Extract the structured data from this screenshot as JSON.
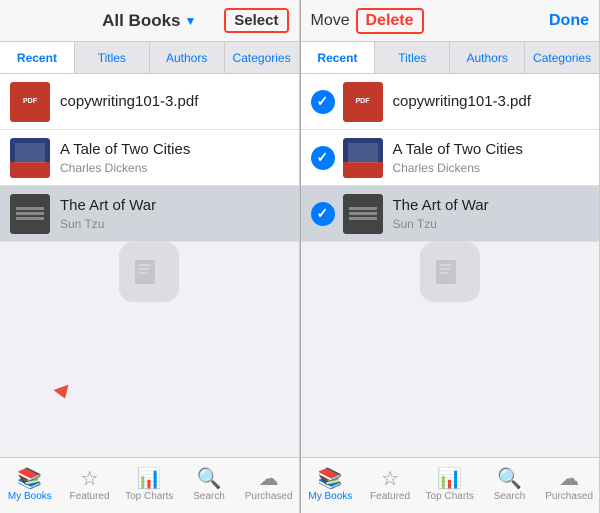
{
  "left_panel": {
    "header": {
      "title": "All Books",
      "title_chevron": "▼",
      "select_label": "Select"
    },
    "tabs": [
      {
        "label": "Recent",
        "active": true
      },
      {
        "label": "Titles",
        "active": false
      },
      {
        "label": "Authors",
        "active": false
      },
      {
        "label": "Categories",
        "active": false
      }
    ],
    "books": [
      {
        "id": "pdf",
        "title": "copywriting101-3.pdf",
        "author": "",
        "cover_type": "pdf"
      },
      {
        "id": "tale",
        "title": "A Tale of Two Cities",
        "author": "Charles Dickens",
        "cover_type": "tale"
      },
      {
        "id": "war",
        "title": "The Art of War",
        "author": "Sun Tzu",
        "cover_type": "war",
        "highlighted": true
      }
    ],
    "tab_bar": [
      {
        "label": "My Books",
        "active": true,
        "icon": "books"
      },
      {
        "label": "Featured",
        "active": false,
        "icon": "star"
      },
      {
        "label": "Top Charts",
        "active": false,
        "icon": "chart"
      },
      {
        "label": "Search",
        "active": false,
        "icon": "search"
      },
      {
        "label": "Purchased",
        "active": false,
        "icon": "cloud"
      }
    ]
  },
  "right_panel": {
    "header": {
      "move_label": "Move",
      "delete_label": "Delete",
      "done_label": "Done"
    },
    "tabs": [
      {
        "label": "Recent",
        "active": true
      },
      {
        "label": "Titles",
        "active": false
      },
      {
        "label": "Authors",
        "active": false
      },
      {
        "label": "Categories",
        "active": false
      }
    ],
    "books": [
      {
        "id": "pdf",
        "title": "copywriting101-3.pdf",
        "author": "",
        "cover_type": "pdf",
        "selected": true
      },
      {
        "id": "tale",
        "title": "A Tale of Two Cities",
        "author": "Charles Dickens",
        "cover_type": "tale",
        "selected": true
      },
      {
        "id": "war",
        "title": "The Art of War",
        "author": "Sun Tzu",
        "cover_type": "war",
        "selected": true,
        "highlighted": true
      }
    ],
    "tab_bar": [
      {
        "label": "My Books",
        "active": true,
        "icon": "books"
      },
      {
        "label": "Featured",
        "active": false,
        "icon": "star"
      },
      {
        "label": "Top Charts",
        "active": false,
        "icon": "chart"
      },
      {
        "label": "Search",
        "active": false,
        "icon": "search"
      },
      {
        "label": "Purchased",
        "active": false,
        "icon": "cloud"
      }
    ]
  }
}
